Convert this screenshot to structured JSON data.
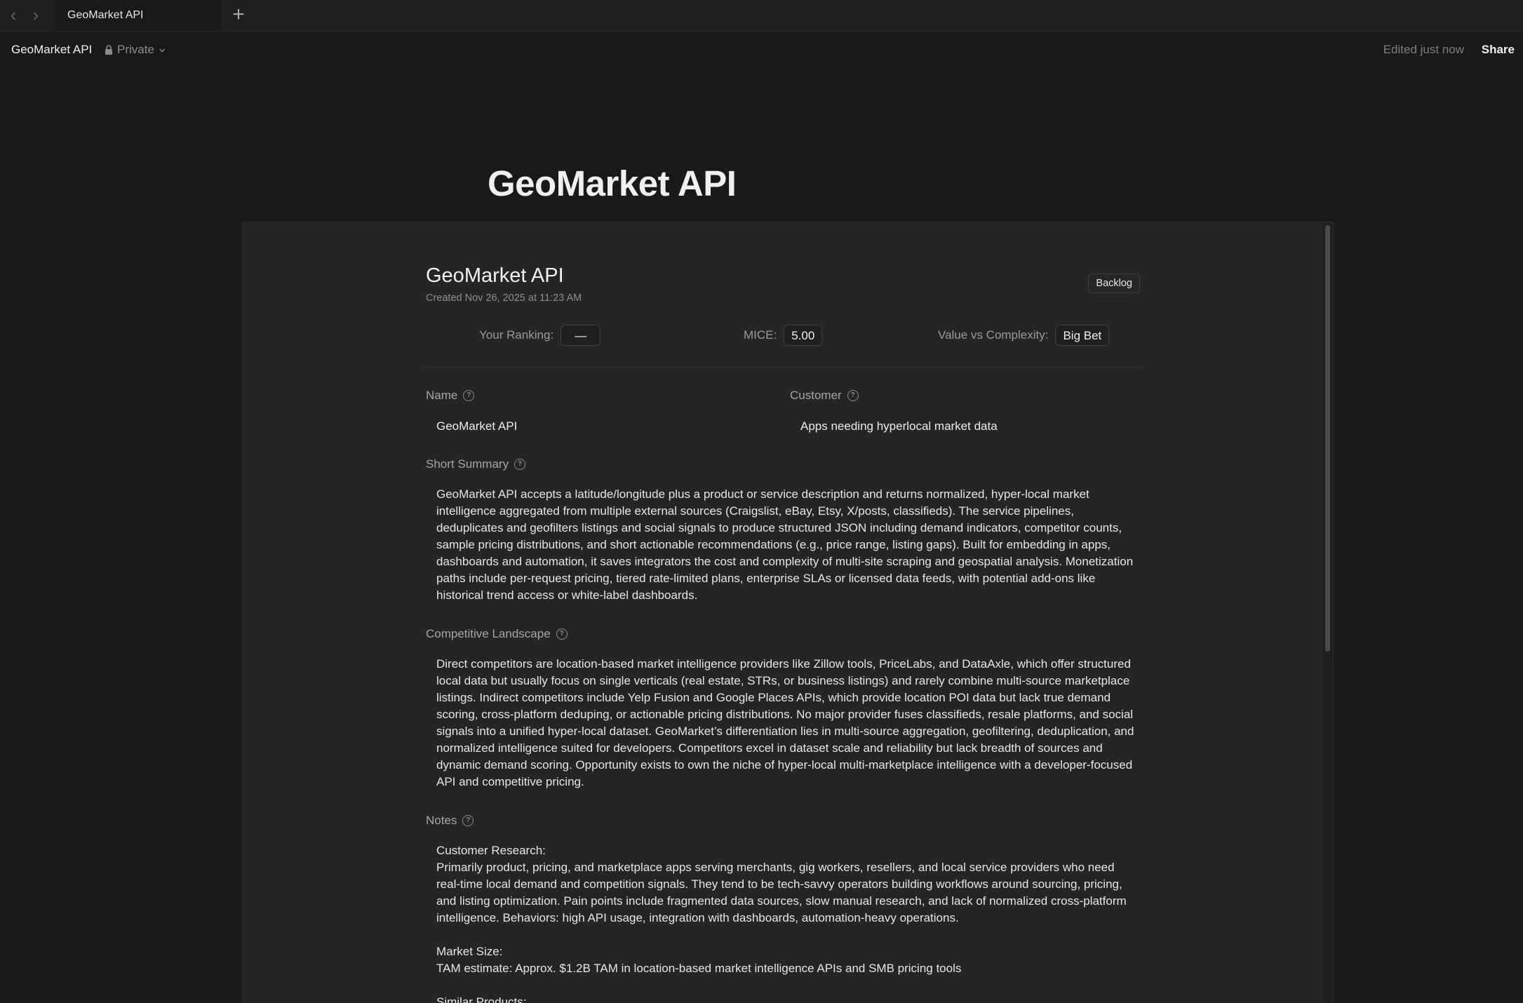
{
  "tabbar": {
    "back_icon": "‹",
    "forward_icon": "›",
    "active_tab": "GeoMarket API",
    "new_tab_icon": "+"
  },
  "topbar": {
    "breadcrumb": "GeoMarket API",
    "privacy": "Private",
    "edited": "Edited just now",
    "share": "Share"
  },
  "page": {
    "title": "GeoMarket API"
  },
  "card": {
    "title": "GeoMarket API",
    "created": "Created Nov 26, 2025 at 11:23 AM",
    "status": "Backlog",
    "metrics": {
      "ranking_label": "Your Ranking:",
      "ranking_value": "—",
      "mice_label": "MICE:",
      "mice_value": "5.00",
      "vc_label": "Value vs Complexity:",
      "vc_value": "Big Bet"
    },
    "fields": {
      "name_label": "Name",
      "name_value": "GeoMarket API",
      "customer_label": "Customer",
      "customer_value": "Apps needing hyperlocal market data",
      "summary_label": "Short Summary",
      "summary_text": "GeoMarket API accepts a latitude/longitude plus a product or service description and returns normalized, hyper-local market intelligence aggregated from multiple external sources (Craigslist, eBay, Etsy, X/posts, classifieds). The service pipelines, deduplicates and geofilters listings and social signals to produce structured JSON including demand indicators, competitor counts, sample pricing distributions, and short actionable recommendations (e.g., price range, listing gaps). Built for embedding in apps, dashboards and automation, it saves integrators the cost and complexity of multi-site scraping and geospatial analysis. Monetization paths include per-request pricing, tiered rate-limited plans, enterprise SLAs or licensed data feeds, with potential add-ons like historical trend access or white-label dashboards.",
      "competitive_label": "Competitive Landscape",
      "competitive_text": "Direct competitors are location-based market intelligence providers like Zillow tools, PriceLabs, and DataAxle, which offer structured local data but usually focus on single verticals (real estate, STRs, or business listings) and rarely combine multi-source marketplace listings. Indirect competitors include Yelp Fusion and Google Places APIs, which provide location POI data but lack true demand scoring, cross-platform deduping, or actionable pricing distributions. No major provider fuses classifieds, resale platforms, and social signals into a unified hyper-local dataset. GeoMarket’s differentiation lies in multi-source aggregation, geofiltering, deduplication, and normalized intelligence suited for developers. Competitors excel in dataset scale and reliability but lack breadth of sources and dynamic demand scoring. Opportunity exists to own the niche of hyper-local multi-marketplace intelligence with a developer-focused API and competitive pricing.",
      "notes_label": "Notes",
      "notes_research_heading": "Customer Research:",
      "notes_research_text": "Primarily product, pricing, and marketplace apps serving merchants, gig workers, resellers, and local service providers who need real-time local demand and competition signals. They tend to be tech-savvy operators building workflows around sourcing, pricing, and listing optimization. Pain points include fragmented data sources, slow manual research, and lack of normalized cross-platform intelligence. Behaviors: high API usage, integration with dashboards, automation-heavy operations.",
      "notes_market_heading": "Market Size:",
      "notes_market_text": "TAM estimate: Approx. $1.2B TAM in location-based market intelligence APIs and SMB pricing tools",
      "notes_similar_heading": "Similar Products:"
    }
  }
}
